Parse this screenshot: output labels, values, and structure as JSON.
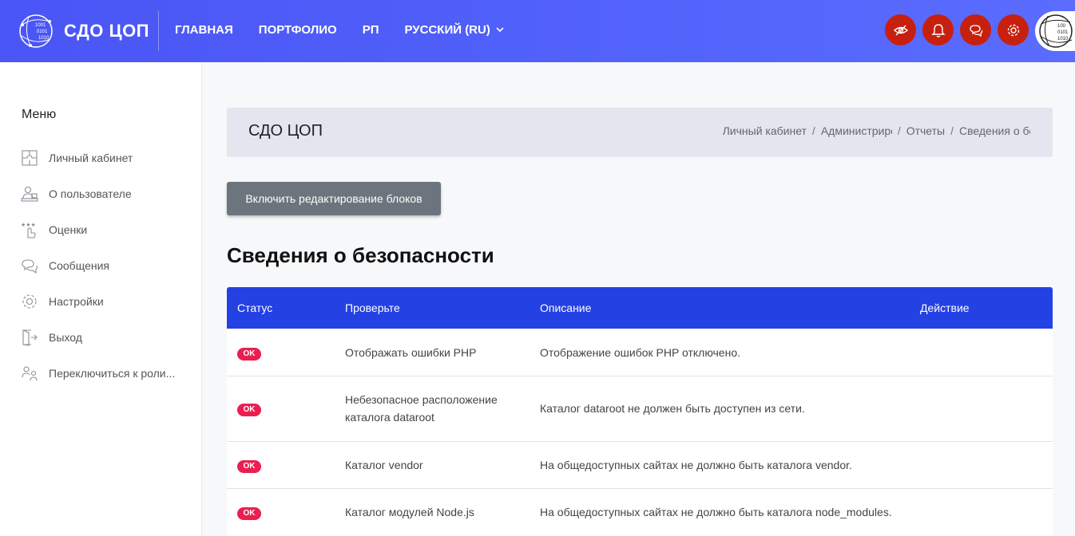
{
  "header": {
    "brand": "СДО ЦОП",
    "logo_text": "1001 0101 1010",
    "nav": [
      "ГЛАВНАЯ",
      "ПОРТФОЛИО",
      "РП"
    ],
    "language": "РУССКИЙ (RU)",
    "icons": [
      "eye-slash-icon",
      "bell-icon",
      "messages-icon",
      "settings-icon"
    ],
    "accent": "#4a55f5",
    "icon_bg": "#c8200e"
  },
  "sidebar": {
    "title": "Меню",
    "items": [
      {
        "label": "Личный кабинет",
        "icon": "puzzle-icon"
      },
      {
        "label": "О пользователе",
        "icon": "user-desk-icon"
      },
      {
        "label": "Оценки",
        "icon": "grades-icon"
      },
      {
        "label": "Сообщения",
        "icon": "messages-icon"
      },
      {
        "label": "Настройки",
        "icon": "settings-icon"
      },
      {
        "label": "Выход",
        "icon": "logout-icon"
      },
      {
        "label": "Переключиться к роли...",
        "icon": "switch-role-icon"
      }
    ]
  },
  "page": {
    "title": "СДО ЦОП",
    "breadcrumb": [
      "Личный кабинет",
      "Администрирование",
      "Отчеты",
      "Сведения о безопасности"
    ],
    "edit_button": "Включить редактирование блоков",
    "section_title": "Сведения о безопасности"
  },
  "table": {
    "columns": [
      "Статус",
      "Проверьте",
      "Описание",
      "Действие"
    ],
    "rows": [
      {
        "status": "OK",
        "check": "Отображать ошибки PHP",
        "description": "Отображение ошибок PHP отключено.",
        "action": ""
      },
      {
        "status": "OK",
        "check": "Небезопасное расположение каталога dataroot",
        "description": "Каталог dataroot не должен быть доступен из сети.",
        "action": ""
      },
      {
        "status": "OK",
        "check": "Каталог vendor",
        "description": "На общедоступных сайтах не должно быть каталога vendor.",
        "action": ""
      },
      {
        "status": "OK",
        "check": "Каталог модулей Node.js",
        "description": "На общедоступных сайтах не должно быть каталога node_modules.",
        "action": ""
      }
    ],
    "header_color": "#2441e3",
    "badge_color": "#ea1f4f"
  }
}
